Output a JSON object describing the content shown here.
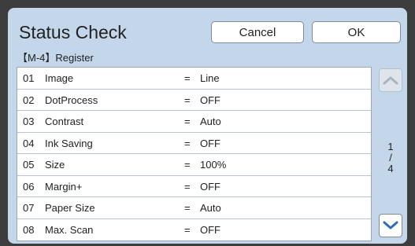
{
  "header": {
    "title": "Status Check",
    "cancel_label": "Cancel",
    "ok_label": "OK"
  },
  "section": {
    "label": "【M-4】Register"
  },
  "rows": [
    {
      "num": "01",
      "name": "Image",
      "eq": "=",
      "value": "Line"
    },
    {
      "num": "02",
      "name": "DotProcess",
      "eq": "=",
      "value": "OFF"
    },
    {
      "num": "03",
      "name": "Contrast",
      "eq": "=",
      "value": "Auto"
    },
    {
      "num": "04",
      "name": "Ink Saving",
      "eq": "=",
      "value": "OFF"
    },
    {
      "num": "05",
      "name": "Size",
      "eq": "=",
      "value": "100%"
    },
    {
      "num": "06",
      "name": "Margin+",
      "eq": "=",
      "value": "OFF"
    },
    {
      "num": "07",
      "name": "Paper Size",
      "eq": "=",
      "value": "Auto"
    },
    {
      "num": "08",
      "name": "Max. Scan",
      "eq": "=",
      "value": "OFF"
    }
  ],
  "pager": {
    "current": "1",
    "separator": "/",
    "total": "4",
    "up_icon": "chevron-up-icon",
    "down_icon": "chevron-down-icon",
    "up_enabled": false,
    "down_enabled": true
  },
  "colors": {
    "panel_background": "#c3d6ea",
    "chevron_active": "#2f6db5",
    "chevron_disabled": "#a9b4bf"
  }
}
